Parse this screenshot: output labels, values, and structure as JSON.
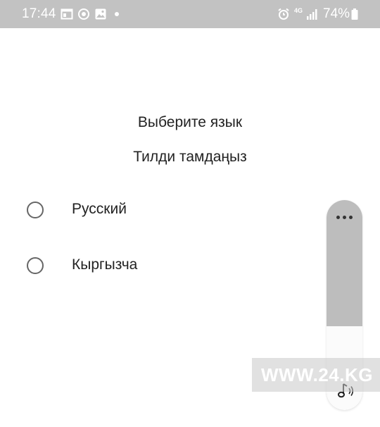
{
  "status_bar": {
    "time": "17:44",
    "network": "4G",
    "battery": "74%",
    "icons": [
      "calendar-icon",
      "sync-icon",
      "gallery-icon",
      "notification-dot",
      "alarm-icon",
      "signal-icon",
      "battery-icon"
    ],
    "background_color": "#c2c2c2"
  },
  "content": {
    "title_ru": "Выберите язык",
    "title_ky": "Тилди тамдаңыз",
    "options": [
      {
        "label": "Русский",
        "selected": false
      },
      {
        "label": "Кыргызча",
        "selected": false
      }
    ]
  },
  "volume_panel": {
    "level": 0.4,
    "icons": [
      "more-icon",
      "music-note-icon"
    ]
  },
  "watermark": {
    "text": "WWW.24.KG"
  }
}
